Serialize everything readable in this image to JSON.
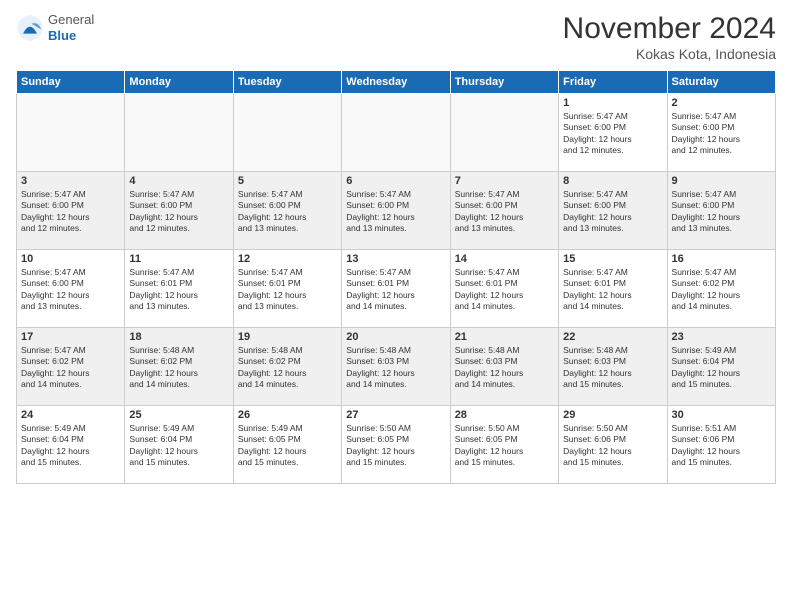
{
  "logo": {
    "general": "General",
    "blue": "Blue"
  },
  "title": "November 2024",
  "subtitle": "Kokas Kota, Indonesia",
  "days_of_week": [
    "Sunday",
    "Monday",
    "Tuesday",
    "Wednesday",
    "Thursday",
    "Friday",
    "Saturday"
  ],
  "weeks": [
    {
      "shaded": false,
      "days": [
        {
          "num": "",
          "info": ""
        },
        {
          "num": "",
          "info": ""
        },
        {
          "num": "",
          "info": ""
        },
        {
          "num": "",
          "info": ""
        },
        {
          "num": "",
          "info": ""
        },
        {
          "num": "1",
          "info": "Sunrise: 5:47 AM\nSunset: 6:00 PM\nDaylight: 12 hours\nand 12 minutes."
        },
        {
          "num": "2",
          "info": "Sunrise: 5:47 AM\nSunset: 6:00 PM\nDaylight: 12 hours\nand 12 minutes."
        }
      ]
    },
    {
      "shaded": true,
      "days": [
        {
          "num": "3",
          "info": "Sunrise: 5:47 AM\nSunset: 6:00 PM\nDaylight: 12 hours\nand 12 minutes."
        },
        {
          "num": "4",
          "info": "Sunrise: 5:47 AM\nSunset: 6:00 PM\nDaylight: 12 hours\nand 12 minutes."
        },
        {
          "num": "5",
          "info": "Sunrise: 5:47 AM\nSunset: 6:00 PM\nDaylight: 12 hours\nand 13 minutes."
        },
        {
          "num": "6",
          "info": "Sunrise: 5:47 AM\nSunset: 6:00 PM\nDaylight: 12 hours\nand 13 minutes."
        },
        {
          "num": "7",
          "info": "Sunrise: 5:47 AM\nSunset: 6:00 PM\nDaylight: 12 hours\nand 13 minutes."
        },
        {
          "num": "8",
          "info": "Sunrise: 5:47 AM\nSunset: 6:00 PM\nDaylight: 12 hours\nand 13 minutes."
        },
        {
          "num": "9",
          "info": "Sunrise: 5:47 AM\nSunset: 6:00 PM\nDaylight: 12 hours\nand 13 minutes."
        }
      ]
    },
    {
      "shaded": false,
      "days": [
        {
          "num": "10",
          "info": "Sunrise: 5:47 AM\nSunset: 6:00 PM\nDaylight: 12 hours\nand 13 minutes."
        },
        {
          "num": "11",
          "info": "Sunrise: 5:47 AM\nSunset: 6:01 PM\nDaylight: 12 hours\nand 13 minutes."
        },
        {
          "num": "12",
          "info": "Sunrise: 5:47 AM\nSunset: 6:01 PM\nDaylight: 12 hours\nand 13 minutes."
        },
        {
          "num": "13",
          "info": "Sunrise: 5:47 AM\nSunset: 6:01 PM\nDaylight: 12 hours\nand 14 minutes."
        },
        {
          "num": "14",
          "info": "Sunrise: 5:47 AM\nSunset: 6:01 PM\nDaylight: 12 hours\nand 14 minutes."
        },
        {
          "num": "15",
          "info": "Sunrise: 5:47 AM\nSunset: 6:01 PM\nDaylight: 12 hours\nand 14 minutes."
        },
        {
          "num": "16",
          "info": "Sunrise: 5:47 AM\nSunset: 6:02 PM\nDaylight: 12 hours\nand 14 minutes."
        }
      ]
    },
    {
      "shaded": true,
      "days": [
        {
          "num": "17",
          "info": "Sunrise: 5:47 AM\nSunset: 6:02 PM\nDaylight: 12 hours\nand 14 minutes."
        },
        {
          "num": "18",
          "info": "Sunrise: 5:48 AM\nSunset: 6:02 PM\nDaylight: 12 hours\nand 14 minutes."
        },
        {
          "num": "19",
          "info": "Sunrise: 5:48 AM\nSunset: 6:02 PM\nDaylight: 12 hours\nand 14 minutes."
        },
        {
          "num": "20",
          "info": "Sunrise: 5:48 AM\nSunset: 6:03 PM\nDaylight: 12 hours\nand 14 minutes."
        },
        {
          "num": "21",
          "info": "Sunrise: 5:48 AM\nSunset: 6:03 PM\nDaylight: 12 hours\nand 14 minutes."
        },
        {
          "num": "22",
          "info": "Sunrise: 5:48 AM\nSunset: 6:03 PM\nDaylight: 12 hours\nand 15 minutes."
        },
        {
          "num": "23",
          "info": "Sunrise: 5:49 AM\nSunset: 6:04 PM\nDaylight: 12 hours\nand 15 minutes."
        }
      ]
    },
    {
      "shaded": false,
      "days": [
        {
          "num": "24",
          "info": "Sunrise: 5:49 AM\nSunset: 6:04 PM\nDaylight: 12 hours\nand 15 minutes."
        },
        {
          "num": "25",
          "info": "Sunrise: 5:49 AM\nSunset: 6:04 PM\nDaylight: 12 hours\nand 15 minutes."
        },
        {
          "num": "26",
          "info": "Sunrise: 5:49 AM\nSunset: 6:05 PM\nDaylight: 12 hours\nand 15 minutes."
        },
        {
          "num": "27",
          "info": "Sunrise: 5:50 AM\nSunset: 6:05 PM\nDaylight: 12 hours\nand 15 minutes."
        },
        {
          "num": "28",
          "info": "Sunrise: 5:50 AM\nSunset: 6:05 PM\nDaylight: 12 hours\nand 15 minutes."
        },
        {
          "num": "29",
          "info": "Sunrise: 5:50 AM\nSunset: 6:06 PM\nDaylight: 12 hours\nand 15 minutes."
        },
        {
          "num": "30",
          "info": "Sunrise: 5:51 AM\nSunset: 6:06 PM\nDaylight: 12 hours\nand 15 minutes."
        }
      ]
    }
  ]
}
